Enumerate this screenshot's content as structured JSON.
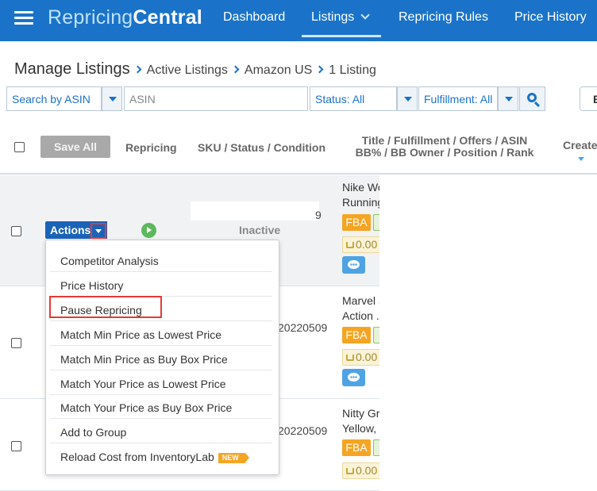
{
  "app": {
    "brand_part1": "Repricing",
    "brand_part2": "Central",
    "accent_color": "#1a73c9"
  },
  "nav": {
    "items": [
      {
        "label": "Dashboard"
      },
      {
        "label": "Listings"
      },
      {
        "label": "Repricing Rules"
      },
      {
        "label": "Price History"
      }
    ],
    "active": "Listings"
  },
  "breadcrumb": {
    "title": "Manage Listings",
    "items": [
      "Active Listings",
      "Amazon US",
      "1 Listing"
    ]
  },
  "filters": {
    "search_by": "Search by ASIN",
    "asin_placeholder": "ASIN",
    "status": "Status: All",
    "fulfillment": "Fulfillment: All",
    "edge_button": "B"
  },
  "table": {
    "save_all": "Save All",
    "columns": {
      "repricing": "Repricing",
      "sku": "SKU / Status / Condition",
      "title_line1": "Title / Fulfillment / Offers / ASIN",
      "title_line2": "BB% / BB Owner / Position / Rank",
      "created": "Created"
    },
    "rows": [
      {
        "status": "Inactive",
        "sku_fragment": "9",
        "title_line1": "Nike Wo",
        "title_line2": "Running",
        "fba": "FBA",
        "price": "0.00"
      },
      {
        "sku_fragment": "20220509",
        "title_line1": "Marvel S",
        "title_line2": "Action ...",
        "fba": "FBA",
        "price": "0.00"
      },
      {
        "sku_fragment": "20220509",
        "title_line1": "Nitty Gri",
        "title_line2": "Yellow, ...",
        "fba": "FBA",
        "price": "0.00"
      }
    ]
  },
  "actions": {
    "label": "Actions",
    "menu": [
      "Competitor Analysis",
      "Price History",
      "Pause Repricing",
      "Match Min Price as Lowest Price",
      "Match Min Price as Buy Box Price",
      "Match Your Price as Lowest Price",
      "Match Your Price as Buy Box Price",
      "Add to Group",
      "Reload Cost from InventoryLab"
    ],
    "highlighted": "Pause Repricing",
    "new_badge": "NEW"
  }
}
